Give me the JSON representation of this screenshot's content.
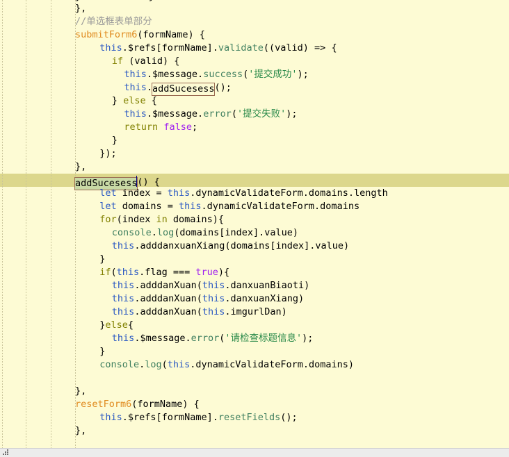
{
  "editor": {
    "theme_name": "pale-yellow",
    "background_color": "#fdfbd4",
    "current_line_color": "#dcd78c",
    "occurrence_border_color": "#9a6b52",
    "selection_color": "#c9d9a5",
    "scrollbar_color": "#ececec",
    "font_size_px": 13.5,
    "line_height_px": 19,
    "colors": {
      "plain": "#000000",
      "comment": "#999999",
      "function": "#e08a1e",
      "keyword": "#7f0055",
      "control_keyword": "#808000",
      "this_keyword": "#2b59c3",
      "property": "#2b59c3",
      "method": "#3f7f5f",
      "string": "#2a8a4a",
      "literal": "#a020f0"
    },
    "current_line_index": 13,
    "caret": {
      "line_index": 13,
      "column": 12
    }
  },
  "clipped_top_line": {
    "text": "partial-line-above"
  },
  "clipped_bottom_line": {
    "text": "partial-line-below"
  },
  "code": {
    "lines": [
      {
        "indent": 2,
        "tokens": [
          {
            "t": "},",
            "c": "plain"
          }
        ]
      },
      {
        "indent": 2,
        "tokens": [
          {
            "t": "//单选框表单部分",
            "c": "comment"
          }
        ]
      },
      {
        "indent": 2,
        "tokens": [
          {
            "t": "submitForm6",
            "c": "function"
          },
          {
            "t": "(formName) {",
            "c": "plain"
          }
        ]
      },
      {
        "indent": 4,
        "tokens": [
          {
            "t": "this",
            "c": "this_keyword"
          },
          {
            "t": ".$refs[formName].",
            "c": "plain"
          },
          {
            "t": "validate",
            "c": "method"
          },
          {
            "t": "((valid) => {",
            "c": "plain"
          }
        ]
      },
      {
        "indent": 5,
        "tokens": [
          {
            "t": "if",
            "c": "control_keyword"
          },
          {
            "t": " (valid) {",
            "c": "plain"
          }
        ]
      },
      {
        "indent": 6,
        "tokens": [
          {
            "t": "this",
            "c": "this_keyword"
          },
          {
            "t": ".$message.",
            "c": "plain"
          },
          {
            "t": "success",
            "c": "method"
          },
          {
            "t": "(",
            "c": "plain"
          },
          {
            "t": "'提交成功'",
            "c": "string"
          },
          {
            "t": ");",
            "c": "plain"
          }
        ]
      },
      {
        "indent": 6,
        "tokens": [
          {
            "t": "this",
            "c": "this_keyword"
          },
          {
            "t": ".",
            "c": "plain"
          },
          {
            "t": "addSucesess",
            "c": "plain",
            "box": true
          },
          {
            "t": "();",
            "c": "plain"
          }
        ]
      },
      {
        "indent": 5,
        "tokens": [
          {
            "t": "} ",
            "c": "plain"
          },
          {
            "t": "else",
            "c": "control_keyword"
          },
          {
            "t": " {",
            "c": "plain"
          }
        ]
      },
      {
        "indent": 6,
        "tokens": [
          {
            "t": "this",
            "c": "this_keyword"
          },
          {
            "t": ".$message.",
            "c": "plain"
          },
          {
            "t": "error",
            "c": "method"
          },
          {
            "t": "(",
            "c": "plain"
          },
          {
            "t": "'提交失败'",
            "c": "string"
          },
          {
            "t": ");",
            "c": "plain"
          }
        ]
      },
      {
        "indent": 6,
        "tokens": [
          {
            "t": "return",
            "c": "control_keyword"
          },
          {
            "t": " ",
            "c": "plain"
          },
          {
            "t": "false",
            "c": "literal"
          },
          {
            "t": ";",
            "c": "plain"
          }
        ]
      },
      {
        "indent": 5,
        "tokens": [
          {
            "t": "}",
            "c": "plain"
          }
        ]
      },
      {
        "indent": 4,
        "tokens": [
          {
            "t": "});",
            "c": "plain"
          }
        ]
      },
      {
        "indent": 2,
        "tokens": [
          {
            "t": "},",
            "c": "plain"
          }
        ]
      },
      {
        "indent": 2,
        "tokens": [
          {
            "t": "addSucesess",
            "c": "plain",
            "box": true,
            "selected": true,
            "caret_after": true
          },
          {
            "t": "() {",
            "c": "plain"
          }
        ]
      },
      {
        "indent": 4,
        "tokens": [
          {
            "t": "let",
            "c": "this_keyword"
          },
          {
            "t": " index = ",
            "c": "plain"
          },
          {
            "t": "this",
            "c": "this_keyword"
          },
          {
            "t": ".dynamicValidateForm.domains.length",
            "c": "plain"
          }
        ]
      },
      {
        "indent": 4,
        "tokens": [
          {
            "t": "let",
            "c": "this_keyword"
          },
          {
            "t": " domains = ",
            "c": "plain"
          },
          {
            "t": "this",
            "c": "this_keyword"
          },
          {
            "t": ".dynamicValidateForm.domains",
            "c": "plain"
          }
        ]
      },
      {
        "indent": 4,
        "tokens": [
          {
            "t": "for",
            "c": "control_keyword"
          },
          {
            "t": "(index ",
            "c": "plain"
          },
          {
            "t": "in",
            "c": "control_keyword"
          },
          {
            "t": " domains){",
            "c": "plain"
          }
        ]
      },
      {
        "indent": 5,
        "tokens": [
          {
            "t": "console",
            "c": "method"
          },
          {
            "t": ".",
            "c": "plain"
          },
          {
            "t": "log",
            "c": "method"
          },
          {
            "t": "(domains[index].value)",
            "c": "plain"
          }
        ]
      },
      {
        "indent": 5,
        "tokens": [
          {
            "t": "this",
            "c": "this_keyword"
          },
          {
            "t": ".adddanxuanXiang(domains[index].value)",
            "c": "plain"
          }
        ]
      },
      {
        "indent": 4,
        "tokens": [
          {
            "t": "}",
            "c": "plain"
          }
        ]
      },
      {
        "indent": 4,
        "tokens": [
          {
            "t": "if",
            "c": "control_keyword"
          },
          {
            "t": "(",
            "c": "plain"
          },
          {
            "t": "this",
            "c": "this_keyword"
          },
          {
            "t": ".flag === ",
            "c": "plain"
          },
          {
            "t": "true",
            "c": "literal"
          },
          {
            "t": "){",
            "c": "plain"
          }
        ]
      },
      {
        "indent": 5,
        "tokens": [
          {
            "t": "this",
            "c": "this_keyword"
          },
          {
            "t": ".adddanXuan(",
            "c": "plain"
          },
          {
            "t": "this",
            "c": "this_keyword"
          },
          {
            "t": ".danxuanBiaoti)",
            "c": "plain"
          }
        ]
      },
      {
        "indent": 5,
        "tokens": [
          {
            "t": "this",
            "c": "this_keyword"
          },
          {
            "t": ".adddanXuan(",
            "c": "plain"
          },
          {
            "t": "this",
            "c": "this_keyword"
          },
          {
            "t": ".danxuanXiang)",
            "c": "plain"
          }
        ]
      },
      {
        "indent": 5,
        "tokens": [
          {
            "t": "this",
            "c": "this_keyword"
          },
          {
            "t": ".adddanXuan(",
            "c": "plain"
          },
          {
            "t": "this",
            "c": "this_keyword"
          },
          {
            "t": ".imgurlDan)",
            "c": "plain"
          }
        ]
      },
      {
        "indent": 4,
        "tokens": [
          {
            "t": "}",
            "c": "plain"
          },
          {
            "t": "else",
            "c": "control_keyword"
          },
          {
            "t": "{",
            "c": "plain"
          }
        ]
      },
      {
        "indent": 5,
        "tokens": [
          {
            "t": "this",
            "c": "this_keyword"
          },
          {
            "t": ".$message.",
            "c": "plain"
          },
          {
            "t": "error",
            "c": "method"
          },
          {
            "t": "(",
            "c": "plain"
          },
          {
            "t": "'请检查标题信息'",
            "c": "string"
          },
          {
            "t": ");",
            "c": "plain"
          }
        ]
      },
      {
        "indent": 4,
        "tokens": [
          {
            "t": "}",
            "c": "plain"
          }
        ]
      },
      {
        "indent": 4,
        "tokens": [
          {
            "t": "console",
            "c": "method"
          },
          {
            "t": ".",
            "c": "plain"
          },
          {
            "t": "log",
            "c": "method"
          },
          {
            "t": "(",
            "c": "plain"
          },
          {
            "t": "this",
            "c": "this_keyword"
          },
          {
            "t": ".dynamicValidateForm.domains)",
            "c": "plain"
          }
        ]
      },
      {
        "indent": 0,
        "tokens": []
      },
      {
        "indent": 2,
        "tokens": [
          {
            "t": "},",
            "c": "plain"
          }
        ]
      },
      {
        "indent": 2,
        "tokens": [
          {
            "t": "resetForm6",
            "c": "function"
          },
          {
            "t": "(formName) {",
            "c": "plain"
          }
        ]
      },
      {
        "indent": 4,
        "tokens": [
          {
            "t": "this",
            "c": "this_keyword"
          },
          {
            "t": ".$refs[formName].",
            "c": "plain"
          },
          {
            "t": "resetFields",
            "c": "method"
          },
          {
            "t": "();",
            "c": "plain"
          }
        ]
      },
      {
        "indent": 2,
        "tokens": [
          {
            "t": "},",
            "c": "plain"
          }
        ]
      },
      {
        "indent": 0,
        "tokens": []
      }
    ]
  },
  "indent_rails": {
    "x_positions": [
      3,
      37,
      73,
      108
    ]
  },
  "bottom_bar": {
    "resize_grip_name": "resize-grip"
  }
}
